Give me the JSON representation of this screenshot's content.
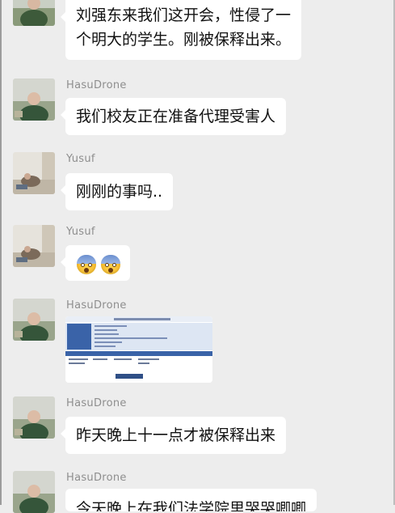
{
  "messages": [
    {
      "sender": "",
      "text_lines": [
        "刘强东来我们这开会，性侵了一",
        "个明大的学生。刚被保释出来。"
      ]
    },
    {
      "sender": "HasuDrone",
      "text": "我们校友正在准备代理受害人"
    },
    {
      "sender": "Yusuf",
      "text": "刚刚的事吗.."
    },
    {
      "sender": "Yusuf",
      "emoji": [
        "fearful-face-icon",
        "fearful-face-icon"
      ]
    },
    {
      "sender": "HasuDrone",
      "attachment": "screenshot-image"
    },
    {
      "sender": "HasuDrone",
      "text": "昨天晚上十一点才被保释出来"
    },
    {
      "sender": "HasuDrone",
      "text": "今天晚上在我们法学院里哭哭唧唧"
    }
  ]
}
